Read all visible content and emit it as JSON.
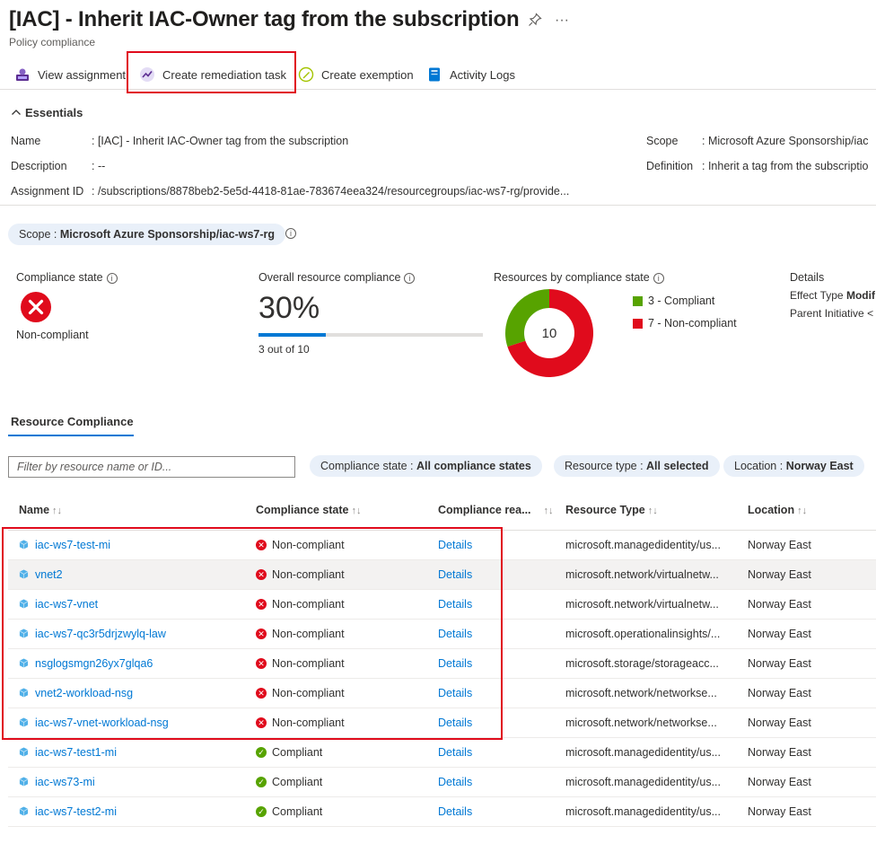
{
  "header": {
    "title": "[IAC] - Inherit IAC-Owner tag from the subscription",
    "subtitle": "Policy compliance",
    "pin_icon": "pin-icon",
    "more_icon": "ellipsis-icon",
    "more_label": "···"
  },
  "toolbar": {
    "view_assignment": "View assignment",
    "create_remediation": "Create remediation task",
    "create_exemption": "Create exemption",
    "activity_logs": "Activity Logs"
  },
  "essentials": {
    "toggle_label": "Essentials",
    "name_label": "Name",
    "name_value": ": [IAC] - Inherit IAC-Owner tag from the subscription",
    "description_label": "Description",
    "description_value": ": --",
    "assignment_label": "Assignment ID",
    "assignment_value": ": /subscriptions/8878beb2-5e5d-4418-81ae-783674eea324/resourcegroups/iac-ws7-rg/provide...",
    "scope_label": "Scope",
    "scope_value": ": Microsoft Azure Sponsorship/iac",
    "definition_label": "Definition",
    "definition_value": ": Inherit a tag from the subscriptio"
  },
  "scope_pill": {
    "label": "Scope : ",
    "value": "Microsoft Azure Sponsorship/iac-ws7-rg"
  },
  "summary": {
    "compliance_state_label": "Compliance state",
    "compliance_state_value": "Non-compliant",
    "overall_label": "Overall resource compliance",
    "overall_pct": "30%",
    "overall_fraction": 0.3,
    "overall_sub": "3 out of 10",
    "by_state_label": "Resources by compliance state",
    "donut_total": "10",
    "legend": [
      {
        "label": "3 - Compliant",
        "value": 3,
        "color": "#57a300"
      },
      {
        "label": "7 - Non-compliant",
        "value": 7,
        "color": "#e00b1c"
      }
    ],
    "details_label": "Details",
    "effect_type_label": "Effect Type",
    "effect_type_value": "Modif",
    "parent_initiative_label": "Parent Initiative",
    "parent_initiative_value": "<"
  },
  "tabs": {
    "resource_compliance": "Resource Compliance"
  },
  "filters": {
    "search_placeholder": "Filter by resource name or ID...",
    "compliance_state_label": "Compliance state : ",
    "compliance_state_value": "All compliance states",
    "resource_type_label": "Resource type : ",
    "resource_type_value": "All selected",
    "location_label": "Location : ",
    "location_value": "Norway East"
  },
  "table": {
    "columns": [
      "Name",
      "Compliance state",
      "Compliance rea...",
      "Resource Type",
      "Location"
    ],
    "sort_glyph": "↑↓",
    "rows": [
      {
        "name": "iac-ws7-test-mi",
        "state": "Non-compliant",
        "ok": false,
        "reason": "Details",
        "type": "microsoft.managedidentity/us...",
        "location": "Norway East"
      },
      {
        "name": "vnet2",
        "state": "Non-compliant",
        "ok": false,
        "reason": "Details",
        "type": "microsoft.network/virtualnetw...",
        "location": "Norway East"
      },
      {
        "name": "iac-ws7-vnet",
        "state": "Non-compliant",
        "ok": false,
        "reason": "Details",
        "type": "microsoft.network/virtualnetw...",
        "location": "Norway East"
      },
      {
        "name": "iac-ws7-qc3r5drjzwylq-law",
        "state": "Non-compliant",
        "ok": false,
        "reason": "Details",
        "type": "microsoft.operationalinsights/...",
        "location": "Norway East"
      },
      {
        "name": "nsglogsmgn26yx7glqa6",
        "state": "Non-compliant",
        "ok": false,
        "reason": "Details",
        "type": "microsoft.storage/storageacc...",
        "location": "Norway East"
      },
      {
        "name": "vnet2-workload-nsg",
        "state": "Non-compliant",
        "ok": false,
        "reason": "Details",
        "type": "microsoft.network/networkse...",
        "location": "Norway East"
      },
      {
        "name": "iac-ws7-vnet-workload-nsg",
        "state": "Non-compliant",
        "ok": false,
        "reason": "Details",
        "type": "microsoft.network/networkse...",
        "location": "Norway East"
      },
      {
        "name": "iac-ws7-test1-mi",
        "state": "Compliant",
        "ok": true,
        "reason": "Details",
        "type": "microsoft.managedidentity/us...",
        "location": "Norway East"
      },
      {
        "name": "iac-ws73-mi",
        "state": "Compliant",
        "ok": true,
        "reason": "Details",
        "type": "microsoft.managedidentity/us...",
        "location": "Norway East"
      },
      {
        "name": "iac-ws7-test2-mi",
        "state": "Compliant",
        "ok": true,
        "reason": "Details",
        "type": "microsoft.managedidentity/us...",
        "location": "Norway East"
      }
    ]
  }
}
